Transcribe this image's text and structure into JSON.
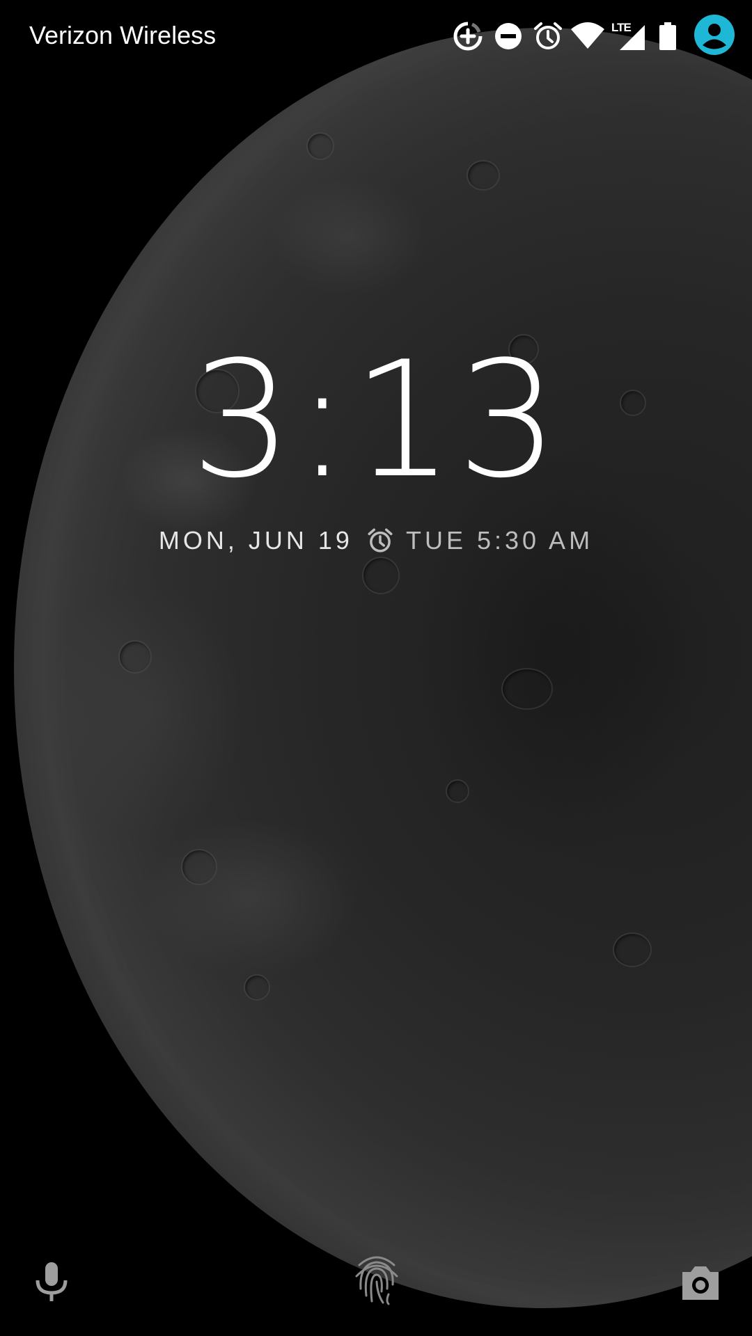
{
  "status_bar": {
    "carrier": "Verizon Wireless",
    "network_type": "LTE",
    "icons": [
      "data-saver-icon",
      "do-not-disturb-icon",
      "alarm-icon",
      "wifi-icon",
      "cellular-signal-icon",
      "battery-icon",
      "user-avatar-icon"
    ],
    "avatar_color": "#1eb8d6"
  },
  "lockscreen": {
    "time": "3:13",
    "date": "MON, JUN 19",
    "next_alarm": "TUE 5:30 AM"
  },
  "bottom": {
    "left_icon": "microphone-icon",
    "center_icon": "fingerprint-icon",
    "right_icon": "camera-icon"
  }
}
